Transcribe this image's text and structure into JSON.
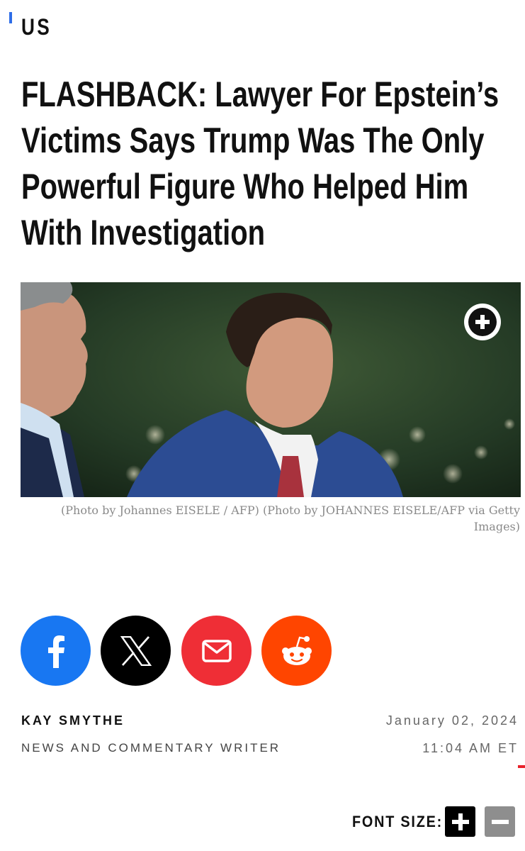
{
  "section": {
    "label": "US"
  },
  "article": {
    "headline_lines": [
      "FLASHBACK: Lawyer For Epstein’s",
      "Victims Says Trump Was The Only",
      "Powerful Figure Who Helped Him",
      "With Investigation"
    ],
    "image_caption": "(Photo by Johannes EISELE / AFP) (Photo by JOHANNES EISELE/AFP via Getty Images)"
  },
  "share": {
    "buttons": [
      "facebook-icon",
      "x-icon",
      "mail-icon",
      "reddit-icon"
    ]
  },
  "byline": {
    "author": "KAY SMYTHE",
    "role": "NEWS AND COMMENTARY WRITER",
    "date": "January 02, 2024",
    "time": "11:04 AM ET"
  },
  "font_controls": {
    "label": "FONT SIZE:"
  },
  "colors": {
    "accent": "#2f6ee8",
    "facebook": "#1877f2",
    "x": "#000000",
    "mail": "#ef2e36",
    "reddit": "#ff4500"
  }
}
